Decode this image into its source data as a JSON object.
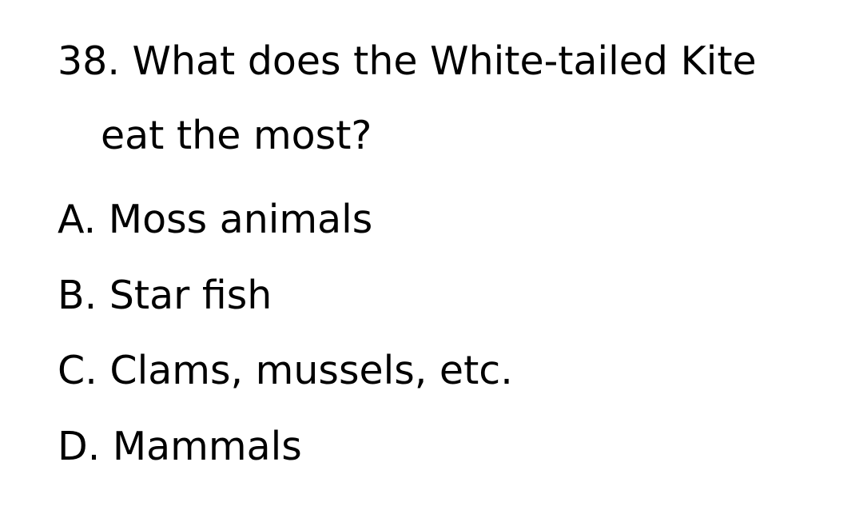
{
  "question": {
    "line1": "38. What does the White-tailed Kite",
    "line2": "eat the most?"
  },
  "options": [
    "A. Moss animals",
    "B. Star fish",
    "C. Clams, mussels, etc.",
    "D. Mammals"
  ]
}
